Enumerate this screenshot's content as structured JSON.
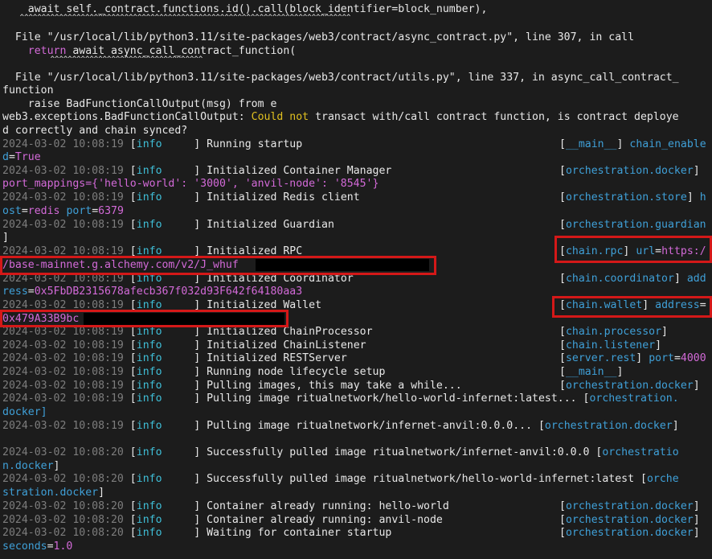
{
  "traceback": {
    "l1": "    await self._contract.functions.id().call(block_identifier=block_number),",
    "l2": "    ^^^^^^^^^^^^^^^^^^^^^^^^^^^^^^^^^^^^^^^^^^^^^^^^^^^^^^^^^^^^^^^^^^^^^^^^^^^^",
    "l3": "  File \"/usr/local/lib/python3.11/site-packages/web3/contract/async_contract.py\", line 307, in call",
    "l4_kw": "return",
    "l4_rest": " await async_call_contract_function(",
    "l5": "           ^^^^^^^^^^^^^^^^^^^^^^^^^^^^^^^^^^^",
    "l6": "  File \"/usr/local/lib/python3.11/site-packages/web3/contract/utils.py\", line 337, in async_call_contract_",
    "l7": "function",
    "l8": "    raise BadFunctionCallOutput(msg) from e",
    "l9_a": "web3.exceptions.BadFunctionCallOutput: ",
    "l9_b": "Could not",
    "l9_c": " transact with/call contract function, is contract deploye",
    "l10": "d correctly and chain synced?"
  },
  "log": {
    "ts1": "2024-03-02 10:08:19",
    "ts2": "2024-03-02 10:08:20",
    "level": "info",
    "r1_msg": "Running startup",
    "r1_mod": "__main__",
    "r1_key": "chain_enable",
    "r1_cont_k": "d",
    "r1_cont_v": "True",
    "r2_msg": "Initialized Container Manager",
    "r2_mod": "orchestration.docker",
    "r2_cont": "port_mappings={'hello-world': '3000', 'anvil-node': '8545'}",
    "r3_msg": "Initialized Redis client",
    "r3_mod": "orchestration.store",
    "r3_key": "h",
    "r3_cont_k": "ost",
    "r3_cont_v": "redis",
    "r3_cont_k2": "port",
    "r3_cont_v2": "6379",
    "r4_msg": "Initialized Guardian",
    "r4_mod": "orchestration.guardian",
    "r4_cont": "]",
    "r5_msg": "Initialized RPC",
    "r5_mod": "chain.rpc",
    "r5_key": "url",
    "r5_val": "https:/",
    "r5_cont": "/base-mainnet.g.alchemy.com/v2/J_whuf",
    "r6_msg": "Initialized Coordinator",
    "r6_mod": "chain.coordinator",
    "r6_key": "add",
    "r6_cont_k": "ress",
    "r6_cont_v": "0x5FbDB2315678afecb367f032d93F642f64180aa3",
    "r7_msg": "Initialized Wallet",
    "r7_mod": "chain.wallet",
    "r7_key": "address",
    "r7_cont": "0x479A33B9bc",
    "r8_msg": "Initialized ChainProcessor",
    "r8_mod": "chain.processor",
    "r9_msg": "Initialized ChainListener",
    "r9_mod": "chain.listener",
    "r10_msg": "Initialized RESTServer",
    "r10_mod": "server.rest",
    "r10_key": "port",
    "r10_val": "4000",
    "r11_msg": "Running node lifecycle setup",
    "r11_mod": "__main__",
    "r12_msg": "Pulling images, this may take a while...",
    "r12_mod": "orchestration.docker",
    "r13_msg": "Pulling image ritualnetwork/hello-world-infernet:latest...",
    "r13_mod": "orchestration.",
    "r13_cont": "docker",
    "r14_msg": "Pulling image ritualnetwork/infernet-anvil:0.0.0...",
    "r14_mod": "orchestration.docker",
    "r15_msg": "Successfully pulled image ritualnetwork/infernet-anvil:0.0.0",
    "r15_mod": "orchestratio",
    "r15_cont": "n.docker",
    "r16_msg": "Successfully pulled image ritualnetwork/hello-world-infernet:latest",
    "r16_mod": "orche",
    "r16_cont": "stration.docker",
    "r17_msg": "Container already running: hello-world",
    "r17_mod": "orchestration.docker",
    "r18_msg": "Container already running: anvil-node",
    "r18_mod": "orchestration.docker",
    "r19_msg": "Waiting for container startup",
    "r19_mod": "orchestration.docker",
    "r19_cont_k": "seconds",
    "r19_cont_v": "1.0"
  }
}
